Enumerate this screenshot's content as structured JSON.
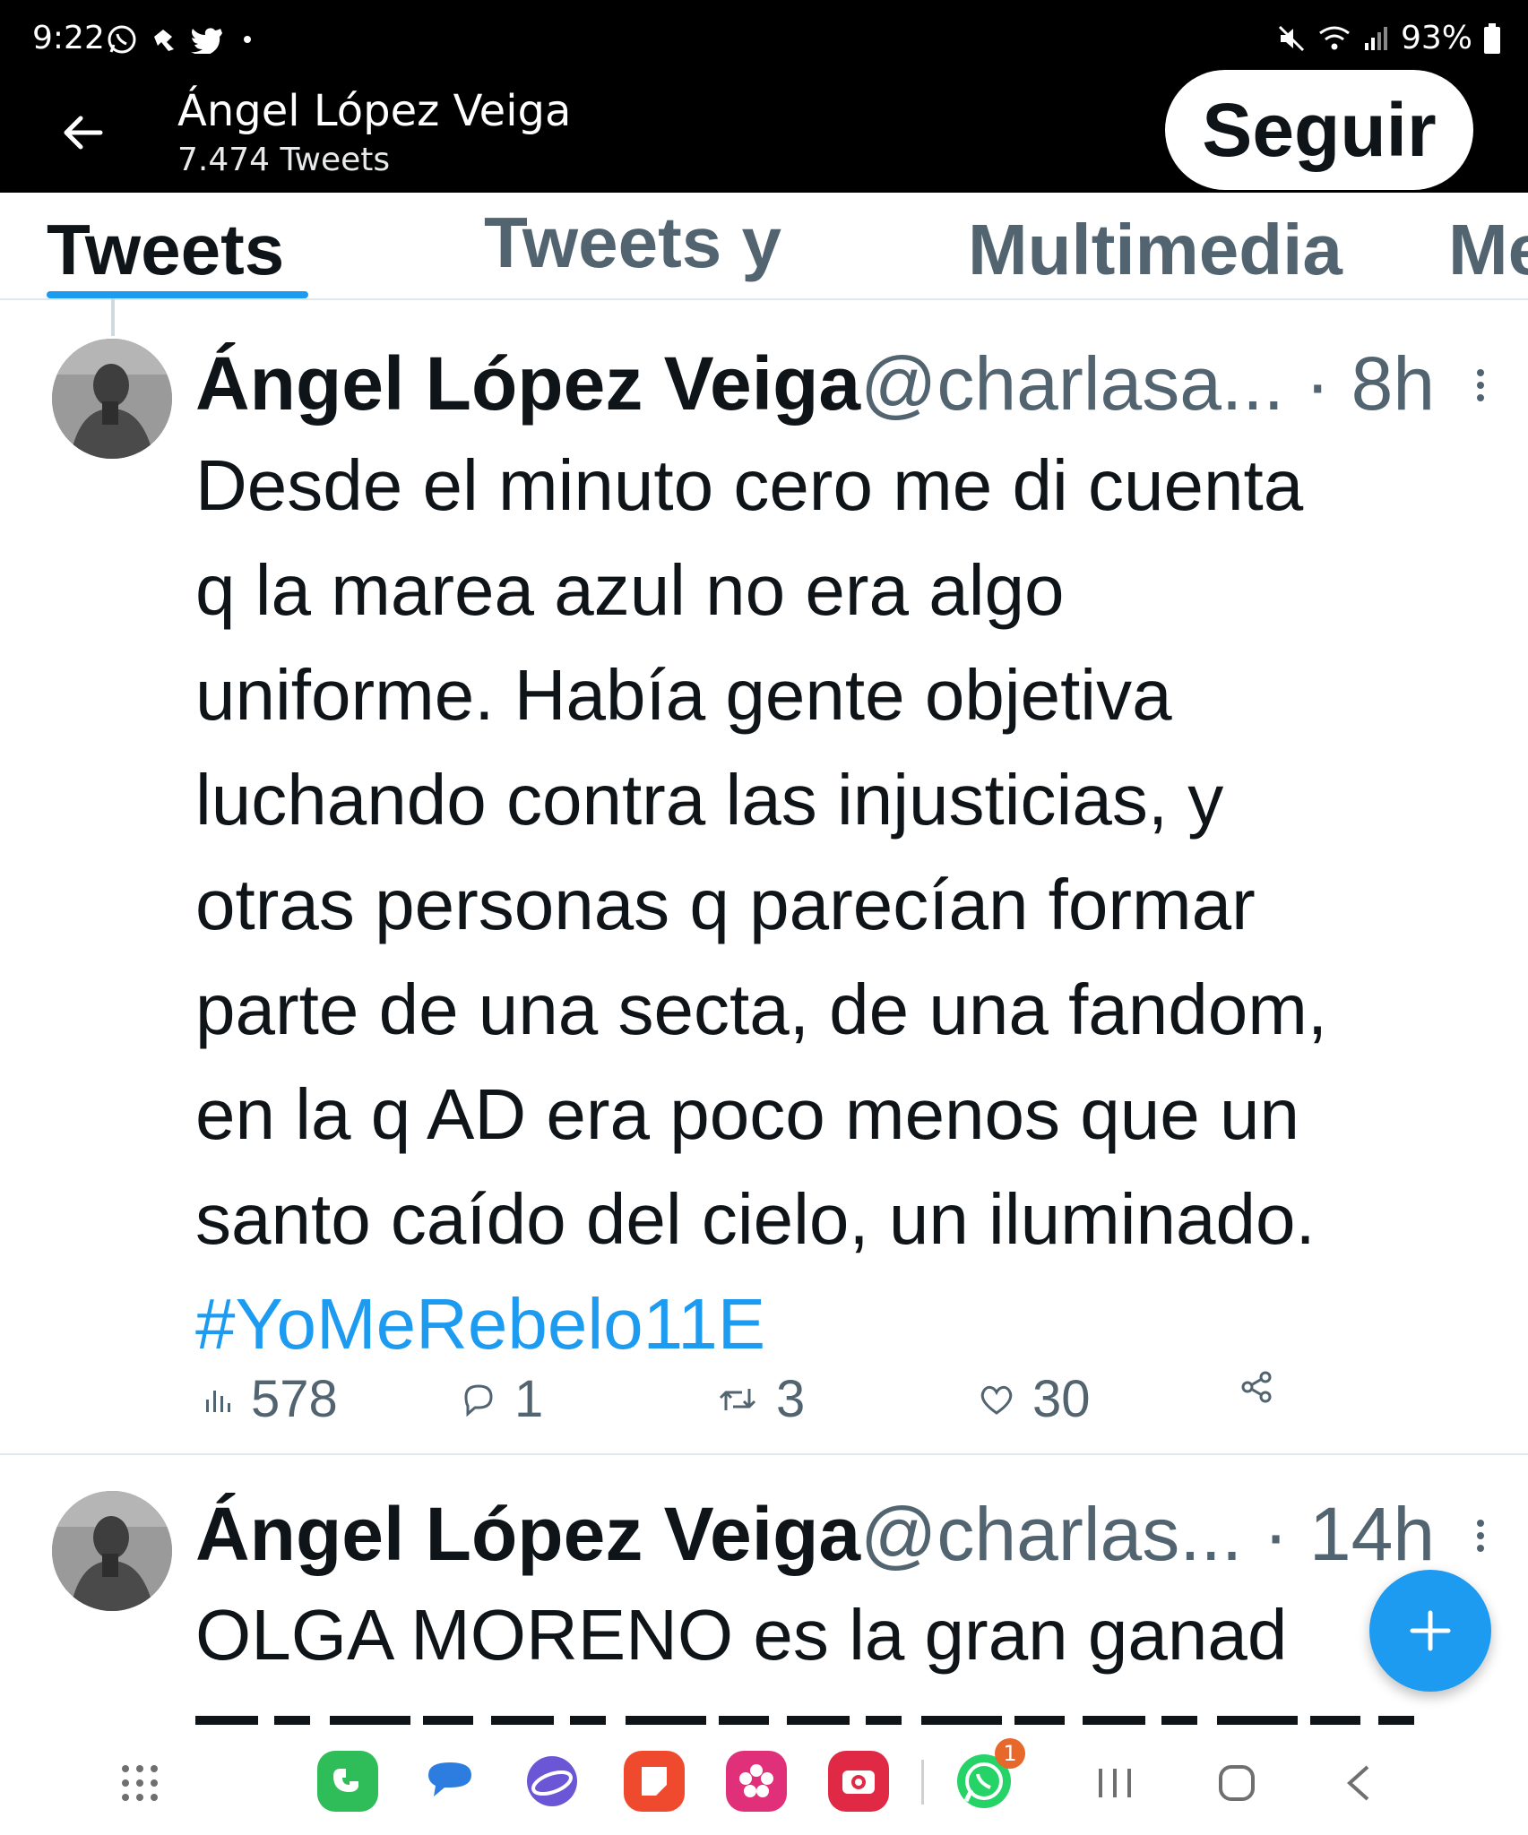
{
  "status_bar": {
    "time": "9:22",
    "battery": "93%"
  },
  "header": {
    "name": "Ángel López Veiga",
    "tweet_count": "7.474 Tweets",
    "follow_label": "Seguir"
  },
  "tabs": [
    {
      "label": "Tweets",
      "active": true
    },
    {
      "label": "Tweets y",
      "active": false
    },
    {
      "label": "Multimedia",
      "active": false
    },
    {
      "label": "Me",
      "active": false
    }
  ],
  "tweets": [
    {
      "name": "Ángel López Veiga",
      "handle": "@charlasa...",
      "separator": "·",
      "time": "8h",
      "lines": [
        "Desde el minuto cero me di cuenta",
        "q la marea azul no era algo",
        "uniforme. Había gente objetiva",
        "luchando contra las injusticias, y",
        "otras personas q parecían formar",
        "parte de una secta, de una fandom,",
        "en la q AD era poco menos que un",
        "santo caído del cielo, un iluminado."
      ],
      "hashtag": "#YoMeRebelo11E",
      "views": "578",
      "replies": "1",
      "retweets": "3",
      "likes": "30"
    },
    {
      "name": "Ángel López Veiga",
      "handle": "@charlas...",
      "separator": "·",
      "time": "14h",
      "lines": [
        "OLGA MORENO es la gran ganad"
      ]
    }
  ],
  "dock": {
    "whatsapp_badge": "1"
  },
  "colors": {
    "accent": "#1d9bf0",
    "text": "#0f1419",
    "muted": "#536471",
    "header_bg": "#000000"
  },
  "icons": [
    "whatsapp-icon",
    "tiktok-icon",
    "twitter-icon",
    "mute-icon",
    "wifi-icon",
    "signal-icon",
    "battery-icon",
    "back-arrow-icon",
    "more-icon",
    "views-icon",
    "reply-icon",
    "retweet-icon",
    "like-icon",
    "share-icon",
    "compose-plus-icon",
    "app-drawer-icon",
    "phone-app-icon",
    "messages-app-icon",
    "internet-app-icon",
    "notes-app-icon",
    "gallery-app-icon",
    "camera-app-icon",
    "whatsapp-app-icon",
    "recents-icon",
    "home-icon",
    "nav-back-icon"
  ]
}
